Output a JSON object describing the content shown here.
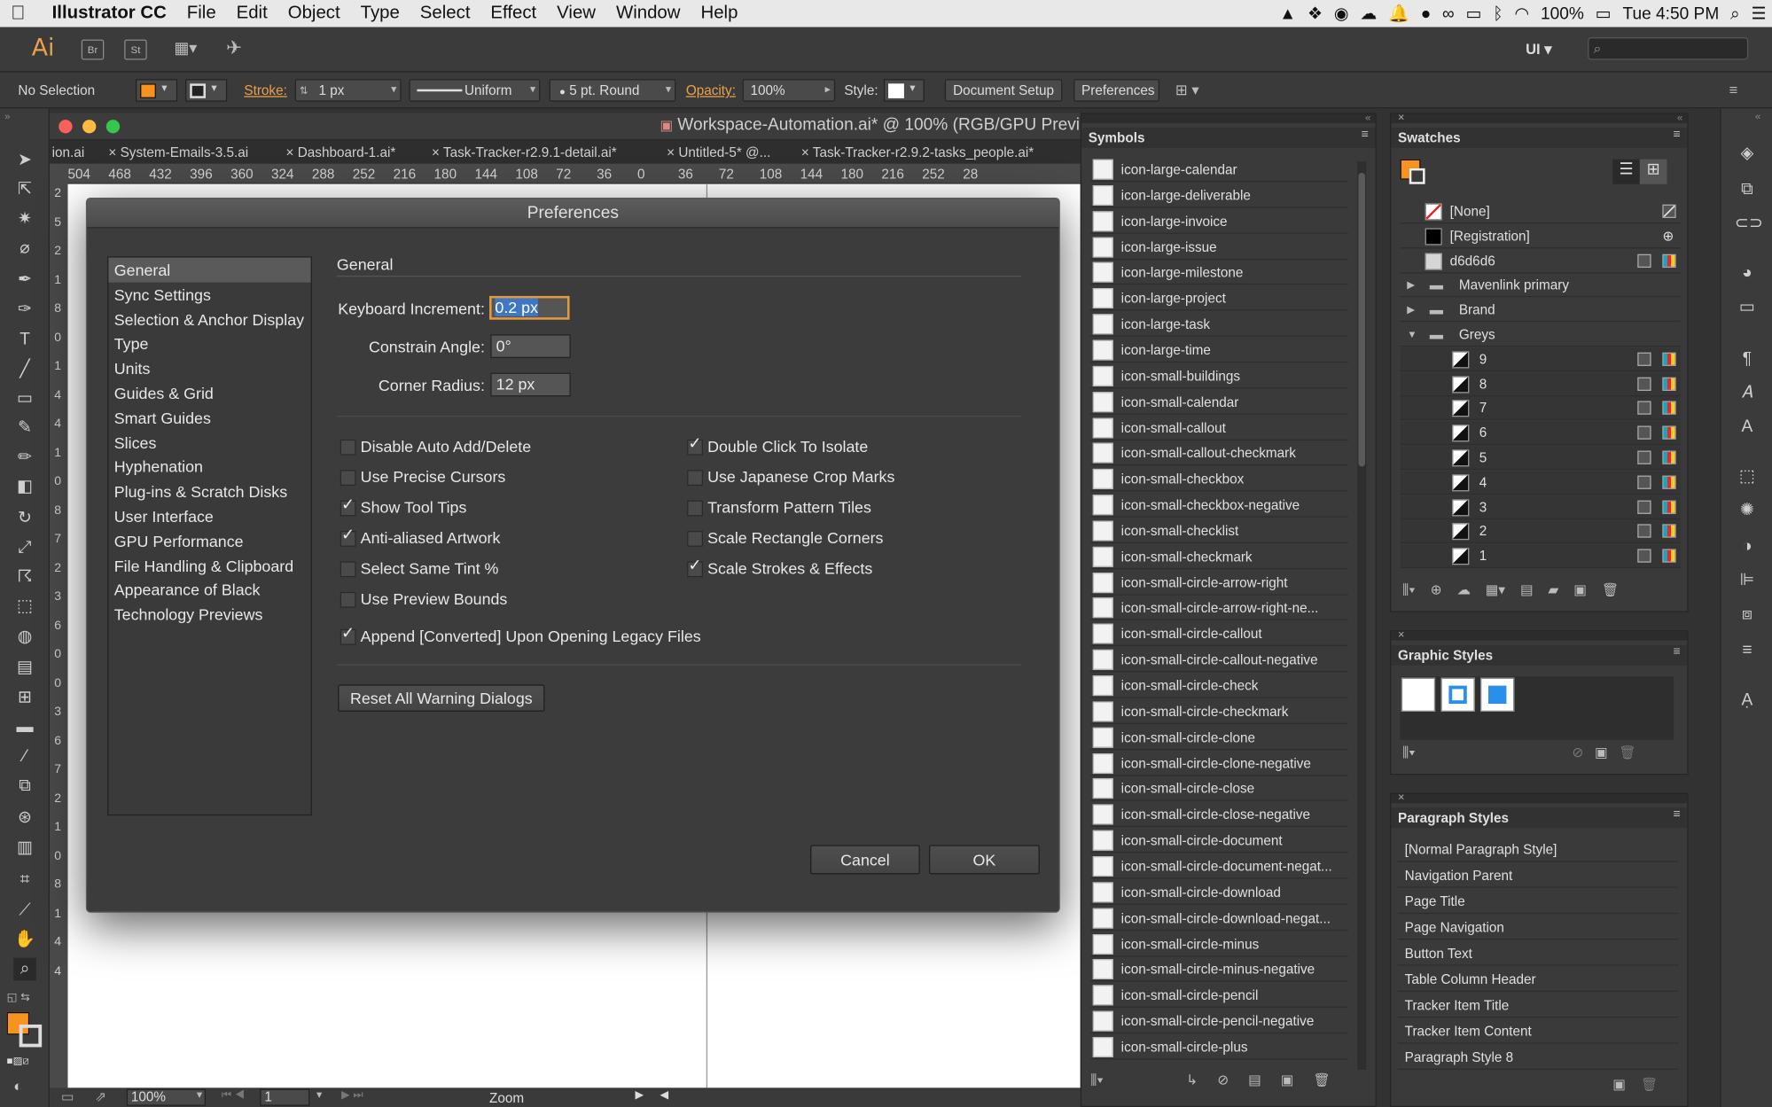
{
  "menubar": {
    "app_name": "Illustrator CC",
    "items": [
      "File",
      "Edit",
      "Object",
      "Type",
      "Select",
      "Effect",
      "View",
      "Window",
      "Help"
    ],
    "battery": "100%",
    "clock": "Tue 4:50 PM"
  },
  "appbar": {
    "logo": "Ai",
    "bridge": "Br",
    "stock": "St",
    "workspace": "UI"
  },
  "control": {
    "selection": "No Selection",
    "stroke_label": "Stroke:",
    "stroke_weight": "1 px",
    "profile": "Uniform",
    "brush": "5 pt. Round",
    "opacity_label": "Opacity:",
    "opacity": "100%",
    "style_label": "Style:",
    "doc_setup": "Document Setup",
    "preferences": "Preferences",
    "fill_color": "#f7931e"
  },
  "document": {
    "title": "Workspace-Automation.ai* @ 100% (RGB/GPU Previ",
    "tabs": [
      "ion.ai",
      "System-Emails-3.5.ai",
      "Dashboard-1.ai*",
      "Task-Tracker-r2.9.1-detail.ai*",
      "Untitled-5* @...",
      "Task-Tracker-r2.9.2-tasks_people.ai*"
    ],
    "ruler": [
      "504",
      "468",
      "432",
      "396",
      "360",
      "324",
      "288",
      "252",
      "216",
      "180",
      "144",
      "108",
      "72",
      "36",
      "0",
      "36",
      "72",
      "108",
      "144",
      "180",
      "216",
      "252",
      "28"
    ],
    "vruler": [
      "2",
      "5",
      "2",
      "1",
      "8",
      "0",
      "1",
      "4",
      "4",
      "1",
      "0",
      "8",
      "7",
      "2",
      "3",
      "6",
      "0",
      "0",
      "3",
      "6",
      "7",
      "2",
      "1",
      "0",
      "8",
      "1",
      "4",
      "4"
    ],
    "zoom": "100%",
    "page": "1",
    "status": "Zoom"
  },
  "preferences": {
    "title": "Preferences",
    "nav": [
      "General",
      "Sync Settings",
      "Selection & Anchor Display",
      "Type",
      "Units",
      "Guides & Grid",
      "Smart Guides",
      "Slices",
      "Hyphenation",
      "Plug-ins & Scratch Disks",
      "User Interface",
      "GPU Performance",
      "File Handling & Clipboard",
      "Appearance of Black",
      "Technology Previews"
    ],
    "section": "General",
    "keyboard_increment_label": "Keyboard Increment:",
    "keyboard_increment": "0.2 px",
    "constrain_angle_label": "Constrain Angle:",
    "constrain_angle": "0°",
    "corner_radius_label": "Corner Radius:",
    "corner_radius": "12 px",
    "checks_left": [
      {
        "label": "Disable Auto Add/Delete",
        "checked": false
      },
      {
        "label": "Use Precise Cursors",
        "checked": false
      },
      {
        "label": "Show Tool Tips",
        "checked": true
      },
      {
        "label": "Anti-aliased Artwork",
        "checked": true
      },
      {
        "label": "Select Same Tint %",
        "checked": false
      },
      {
        "label": "Use Preview Bounds",
        "checked": false
      }
    ],
    "checks_right": [
      {
        "label": "Double Click To Isolate",
        "checked": true
      },
      {
        "label": "Use Japanese Crop Marks",
        "checked": false
      },
      {
        "label": "Transform Pattern Tiles",
        "checked": false
      },
      {
        "label": "Scale Rectangle Corners",
        "checked": false
      },
      {
        "label": "Scale Strokes & Effects",
        "checked": true
      }
    ],
    "append_converted": {
      "label": "Append [Converted] Upon Opening Legacy Files",
      "checked": true
    },
    "reset_warnings": "Reset All Warning Dialogs",
    "cancel": "Cancel",
    "ok": "OK"
  },
  "symbols": {
    "title": "Symbols",
    "items": [
      "icon-large-calendar",
      "icon-large-deliverable",
      "icon-large-invoice",
      "icon-large-issue",
      "icon-large-milestone",
      "icon-large-project",
      "icon-large-task",
      "icon-large-time",
      "icon-small-buildings",
      "icon-small-calendar",
      "icon-small-callout",
      "icon-small-callout-checkmark",
      "icon-small-checkbox",
      "icon-small-checkbox-negative",
      "icon-small-checklist",
      "icon-small-checkmark",
      "icon-small-circle-arrow-right",
      "icon-small-circle-arrow-right-ne...",
      "icon-small-circle-callout",
      "icon-small-circle-callout-negative",
      "icon-small-circle-check",
      "icon-small-circle-checkmark",
      "icon-small-circle-clone",
      "icon-small-circle-clone-negative",
      "icon-small-circle-close",
      "icon-small-circle-close-negative",
      "icon-small-circle-document",
      "icon-small-circle-document-negat...",
      "icon-small-circle-download",
      "icon-small-circle-download-negat...",
      "icon-small-circle-minus",
      "icon-small-circle-minus-negative",
      "icon-small-circle-pencil",
      "icon-small-circle-pencil-negative",
      "icon-small-circle-plus"
    ]
  },
  "swatches": {
    "title": "Swatches",
    "items": [
      {
        "name": "[None]",
        "type": "none"
      },
      {
        "name": "[Registration]",
        "type": "registration"
      },
      {
        "name": "d6d6d6",
        "type": "color",
        "color": "#d6d6d6"
      },
      {
        "name": "Mavenlink primary",
        "type": "group",
        "expanded": false
      },
      {
        "name": "Brand",
        "type": "group",
        "expanded": false
      },
      {
        "name": "Greys",
        "type": "group",
        "expanded": true
      }
    ],
    "greys": [
      "9",
      "8",
      "7",
      "6",
      "5",
      "4",
      "3",
      "2",
      "1"
    ]
  },
  "graphic_styles": {
    "title": "Graphic Styles"
  },
  "paragraph_styles": {
    "title": "Paragraph Styles",
    "items": [
      "[Normal Paragraph Style]",
      "Navigation Parent",
      "Page Title",
      "Page Navigation",
      "Button Text",
      "Table Column Header",
      "Tracker Item Title",
      "Tracker Item Content",
      "Paragraph Style 8"
    ]
  }
}
